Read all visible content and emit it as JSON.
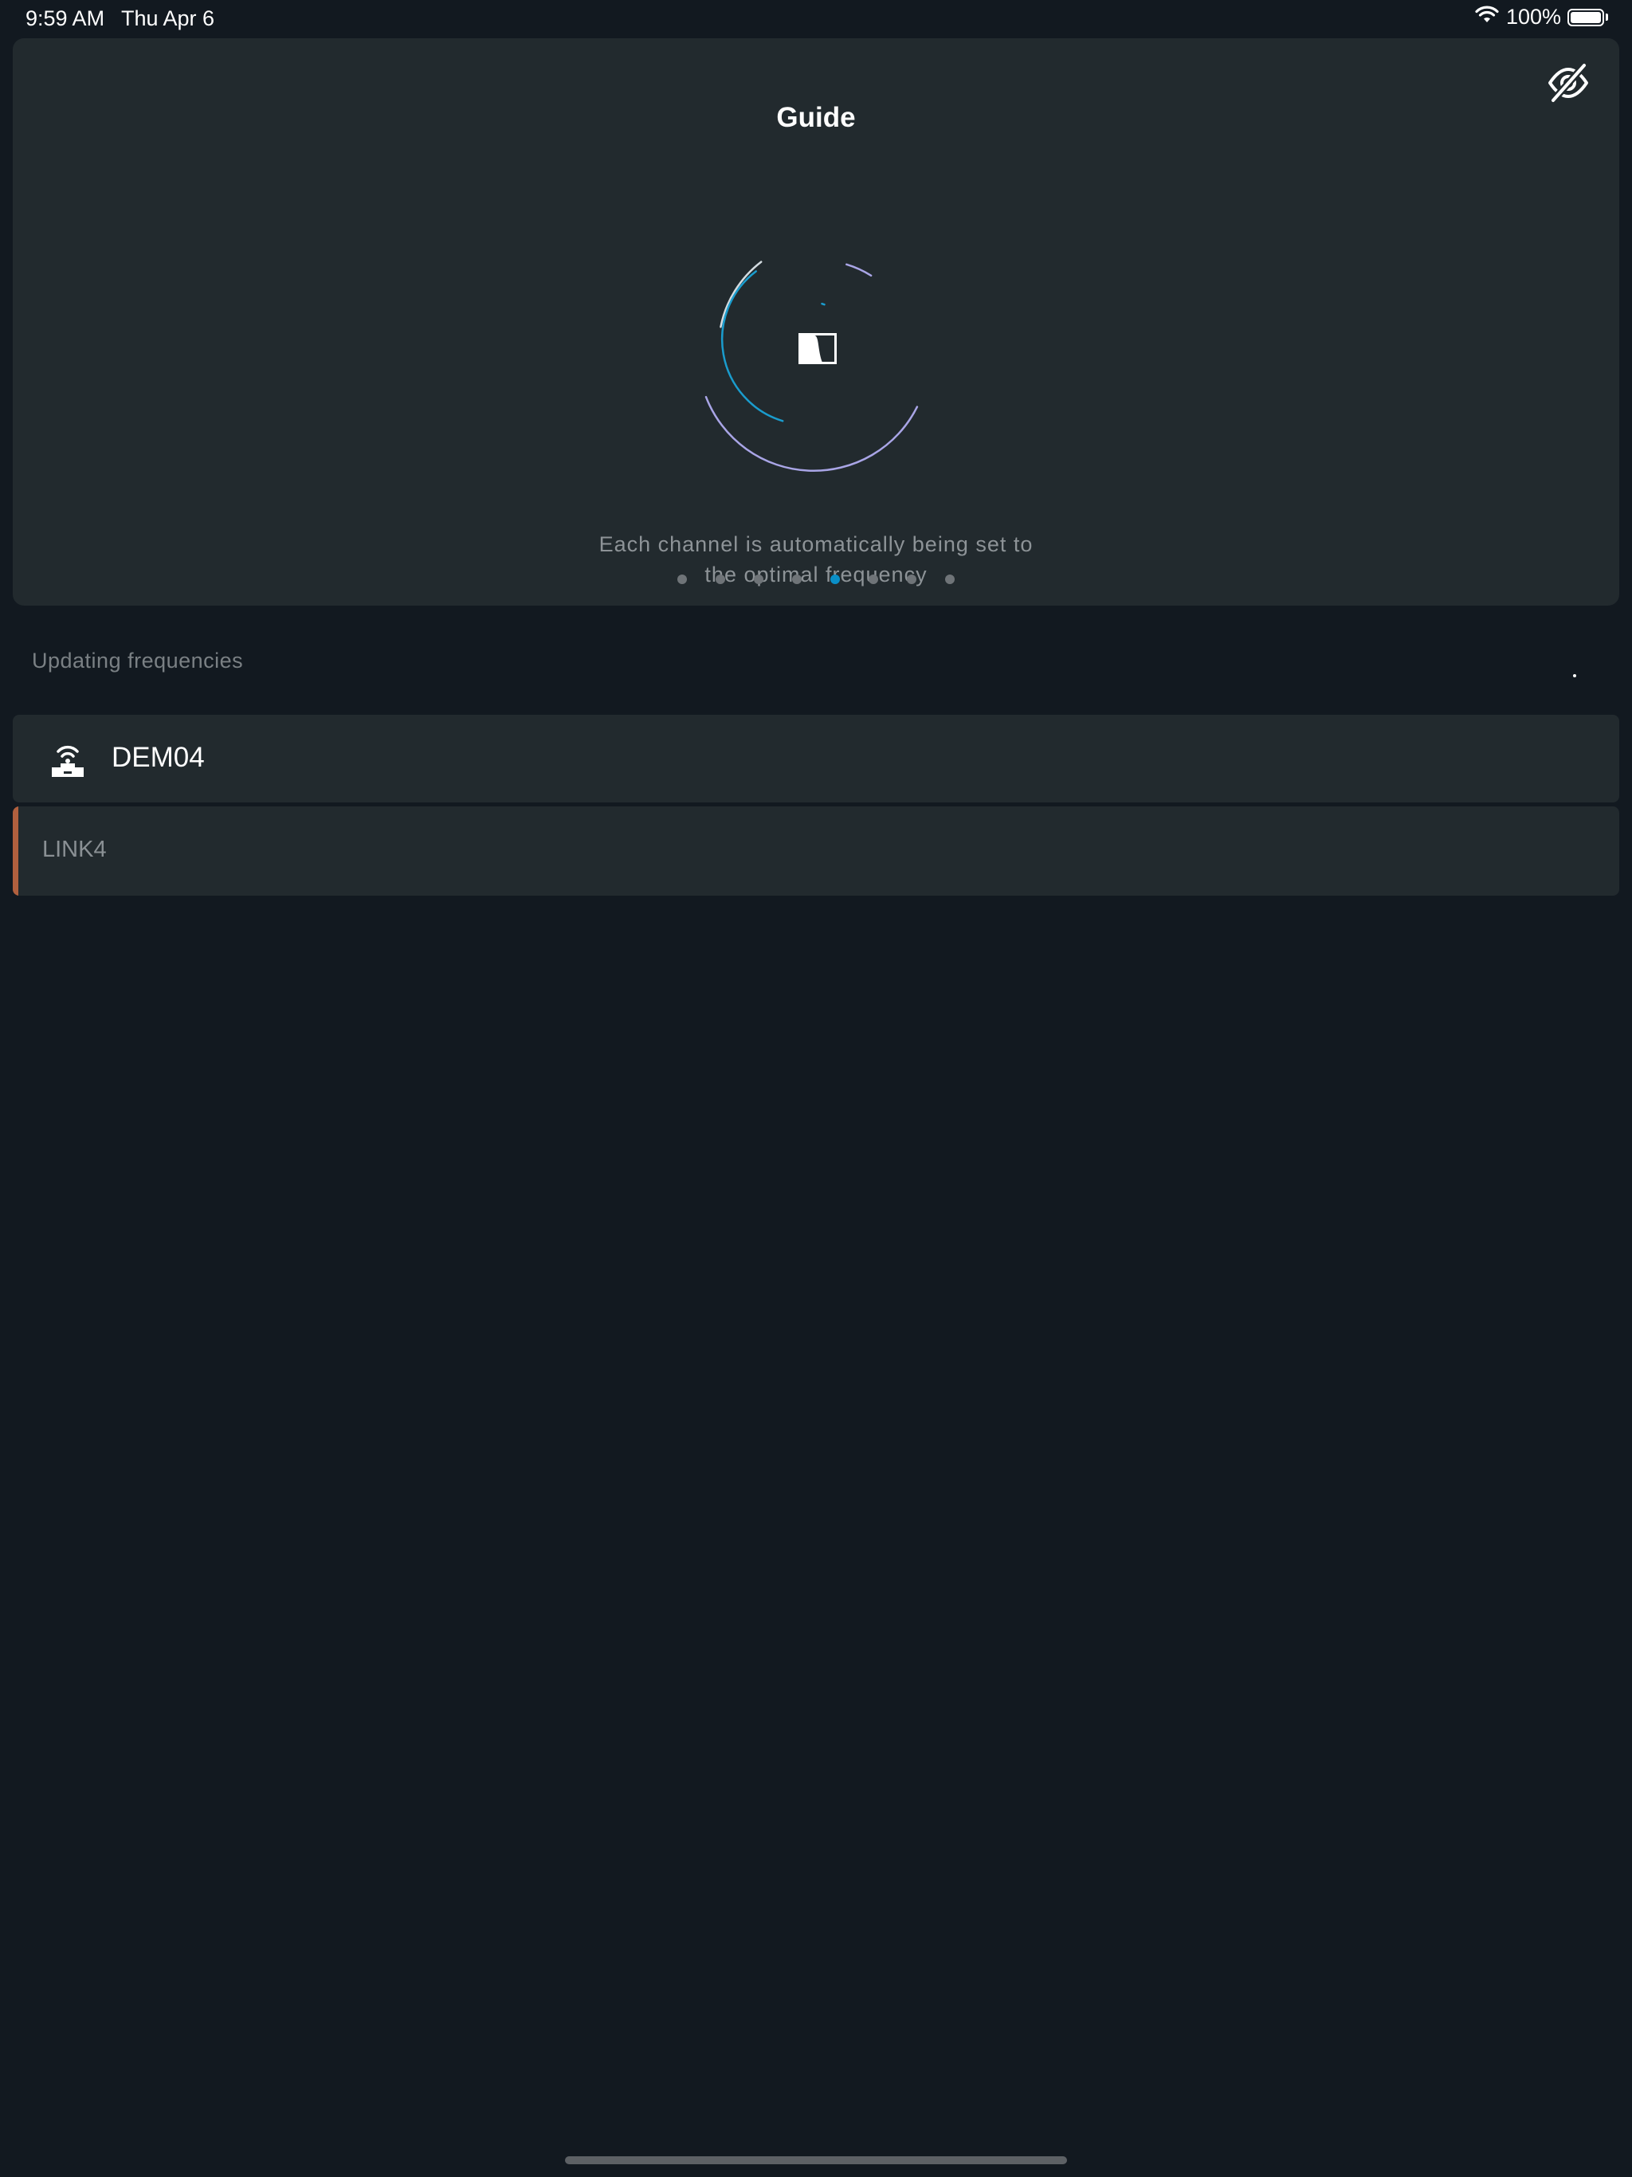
{
  "status_bar": {
    "time": "9:59 AM",
    "date": "Thu Apr 6",
    "battery_text": "100%",
    "wifi_icon": "wifi-icon",
    "battery_icon": "battery-full-icon"
  },
  "guide": {
    "title": "Guide",
    "hide_icon": "eye-slash-icon",
    "logo_icon": "sennheiser-logo-icon",
    "description_line1": "Each channel is automatically being set to",
    "description_line2": "the optimal frequency",
    "pager": {
      "total": 8,
      "active_index": 4
    }
  },
  "section": {
    "label": "Updating frequencies"
  },
  "device": {
    "name": "DEM04",
    "icon": "wireless-receiver-icon",
    "channels": [
      {
        "name": "LINK4",
        "status_color": "#b1603e"
      }
    ]
  },
  "colors": {
    "background": "#121920",
    "card": "#222a2e",
    "accent_blue": "#0a8fc8",
    "arc_purple": "#a9a5e6",
    "arc_blue": "#1a9ccd"
  }
}
